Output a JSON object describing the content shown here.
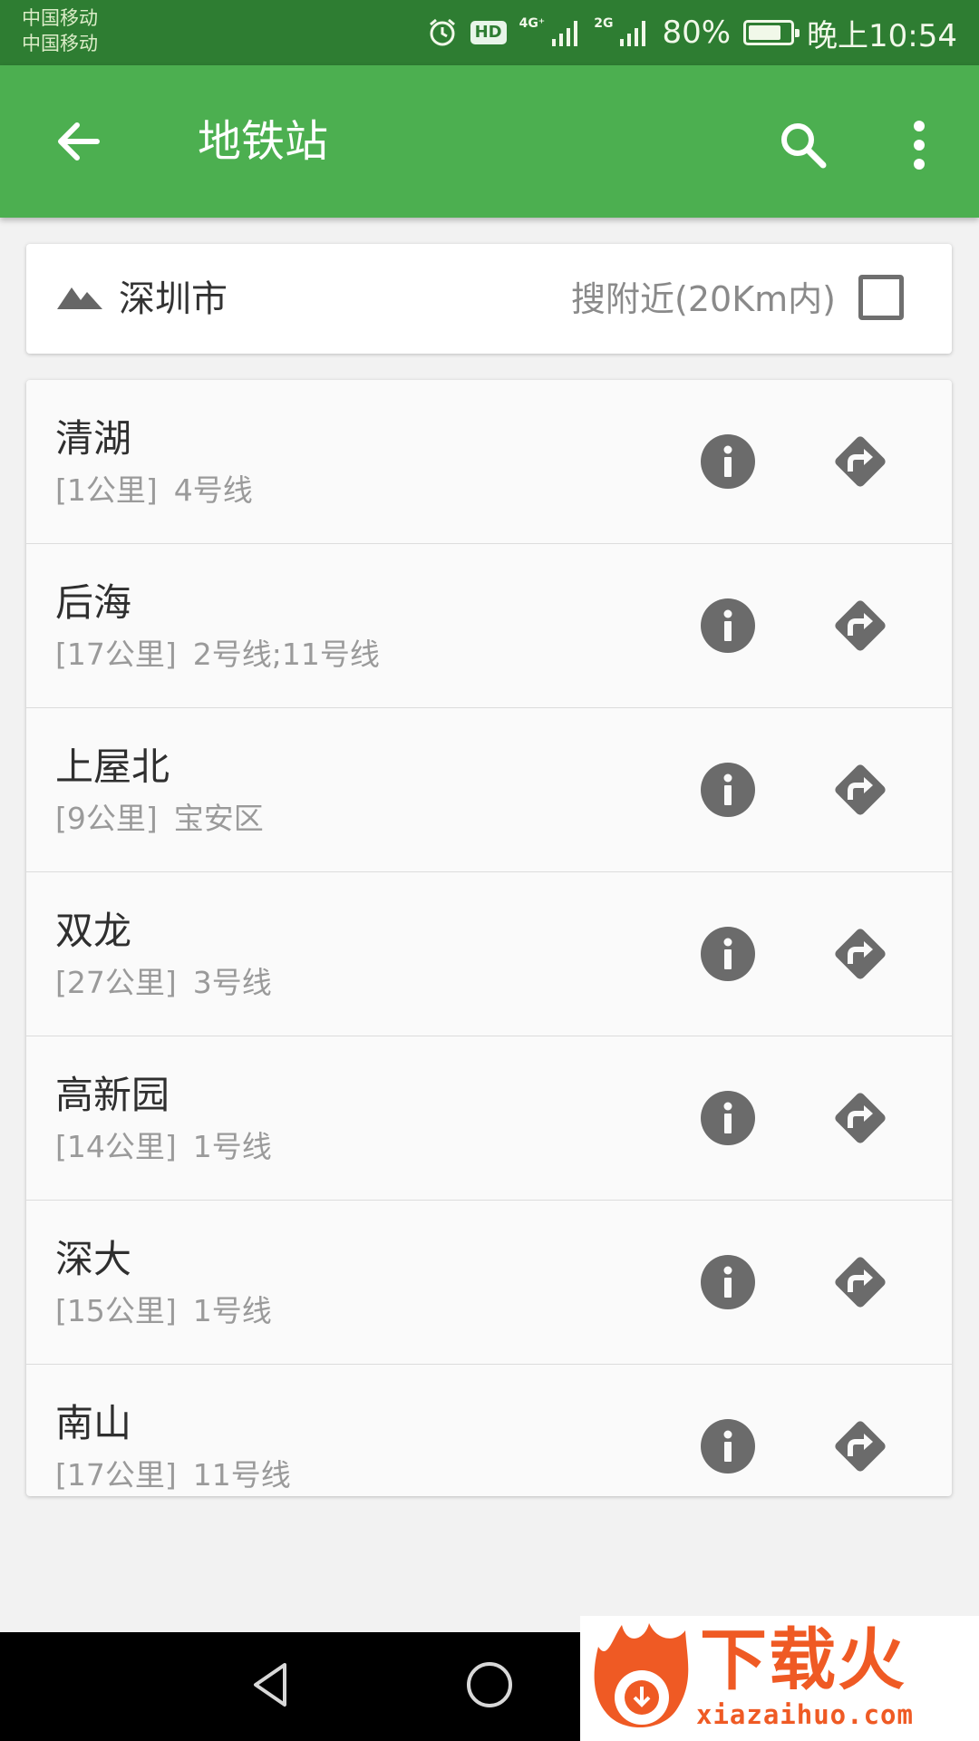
{
  "status_bar": {
    "carrier_1": "中国移动",
    "carrier_2": "中国移动",
    "icons": [
      "alarm-icon",
      "hd-icon",
      "signal-4g-icon",
      "signal-2g-icon",
      "battery-icon"
    ],
    "hd": "HD",
    "net_1": "4G⁺",
    "net_2": "2G",
    "battery_percent_text": "80%",
    "battery_level": 0.8,
    "time": "晚上10:54"
  },
  "app_bar": {
    "title": "地铁站",
    "back_icon": "arrow-left-icon",
    "search_icon": "search-icon",
    "more_icon": "more-vert-icon",
    "background": "#4caf50"
  },
  "filter": {
    "region_icon": "terrain-icon",
    "city": "深圳市",
    "nearby_label": "搜附近(20Km内)",
    "nearby_checked": false
  },
  "stations": [
    {
      "name": "清湖",
      "distance": "[1公里]",
      "lines": "4号线"
    },
    {
      "name": "后海",
      "distance": "[17公里]",
      "lines": "2号线;11号线"
    },
    {
      "name": "上屋北",
      "distance": "[9公里]",
      "lines": "宝安区"
    },
    {
      "name": "双龙",
      "distance": "[27公里]",
      "lines": "3号线"
    },
    {
      "name": "高新园",
      "distance": "[14公里]",
      "lines": "1号线"
    },
    {
      "name": "深大",
      "distance": "[15公里]",
      "lines": "1号线"
    },
    {
      "name": "南山",
      "distance": "[17公里]",
      "lines": "11号线"
    }
  ],
  "station_actions": {
    "info_icon": "info-icon",
    "route_icon": "directions-icon",
    "icon_color": "#6b6b6b"
  },
  "nav_bar": {
    "back_icon": "nav-back-triangle-icon",
    "home_icon": "nav-home-circle-icon"
  },
  "watermark": {
    "title": "下载火",
    "url": "xiazaihuo.com",
    "color": "#ef5a24"
  }
}
